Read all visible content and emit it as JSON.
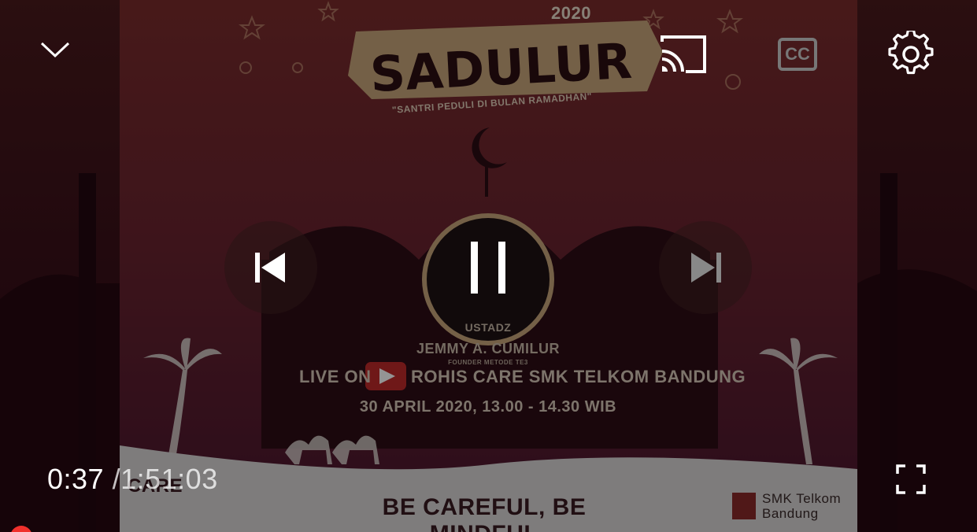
{
  "player": {
    "current_time": "0:37",
    "separator": "/",
    "duration": "1:51:03",
    "progress_fraction": 0.0056,
    "accent_color": "#f0302c",
    "state": "playing"
  },
  "controls": {
    "collapse": {
      "icon": "chevron-down-icon"
    },
    "cast": {
      "icon": "cast-icon"
    },
    "captions": {
      "icon": "closed-captions-icon",
      "label": "CC"
    },
    "settings": {
      "icon": "gear-icon"
    },
    "previous": {
      "icon": "skip-previous-icon"
    },
    "play_pause": {
      "icon": "pause-icon"
    },
    "next": {
      "icon": "skip-next-icon"
    },
    "fullscreen": {
      "icon": "fullscreen-icon"
    }
  },
  "video_frame": {
    "year": "2020",
    "title": "SADULUR",
    "subtitle": "\"SANTRI PEDULI DI BULAN RAMADHAN\"",
    "speaker_prefix": "USTADZ",
    "speaker_name": "JEMMY A. CUMILUR",
    "speaker_role": "FOUNDER METODE TE3",
    "live_on": "LIVE ON",
    "channel": "ROHIS CARE SMK TELKOM BANDUNG",
    "schedule": "30 APRIL 2020, 13.00 - 14.30 WIB",
    "tagline": "BE CAREFUL, BE MINDFUL",
    "care_logo": "CARE",
    "school_logo_line1": "SMK Telkom",
    "school_logo_line2": "Bandung"
  }
}
